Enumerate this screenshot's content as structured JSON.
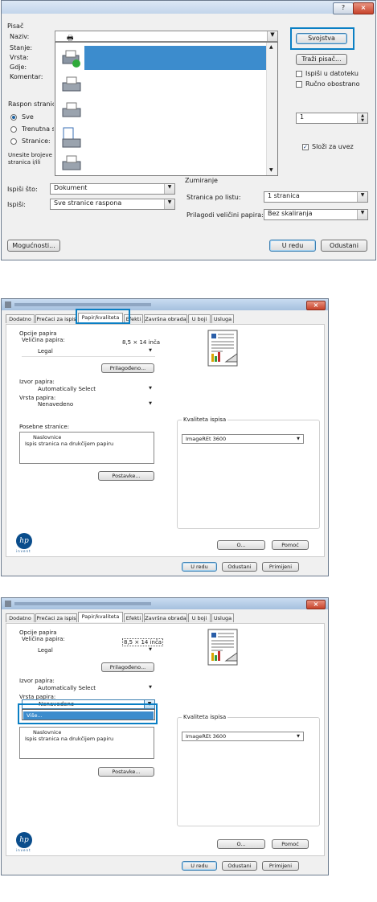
{
  "print_dialog": {
    "help_label": "?",
    "close_label": "×",
    "printer_section": "Pisač",
    "name_label": "Naziv:",
    "status_label": "Stanje:",
    "type_label": "Vrsta:",
    "where_label": "Gdje:",
    "comment_label": "Komentar:",
    "properties_button": "Svojstva",
    "find_printer_button": "Traži pisač...",
    "print_to_file_label": "Ispiši u datoteku",
    "manual_duplex_label": "Ručno obostrano",
    "page_range_label": "Raspon stranica",
    "all_label": "Sve",
    "current_label": "Trenutna s",
    "pages_label": "Stranice:",
    "range_hint": "Unesite brojeve stranica i/ili raspone stranica odvojene zarezima",
    "copies_value": "1",
    "collate_label": "Složi za uvez",
    "print_what_label": "Ispiši što:",
    "print_what_value": "Dokument",
    "print_label": "Ispiši:",
    "print_value": "Sve stranice raspona",
    "zoom_label": "Zumiranje",
    "pages_per_sheet_label": "Stranica po listu:",
    "pages_per_sheet_value": "1 stranica",
    "scale_label": "Prilagodi veličini papira:",
    "scale_value": "Bez skaliranja",
    "options_button": "Mogućnosti...",
    "ok_button": "U redu",
    "cancel_button": "Odustani"
  },
  "props_dialog": {
    "close_label": "×",
    "tabs": [
      "Dodatno",
      "Prečaci za ispis",
      "Papir/kvaliteta",
      "Efekti",
      "Završna obrada",
      "U boji",
      "Usluga"
    ],
    "paper_options_label": "Opcije papira",
    "paper_size_label": "Veličina papira:",
    "paper_size_dims": "8,5 × 14 inča",
    "paper_size_value": "Legal",
    "custom_button": "Prilagođeno...",
    "paper_source_label": "Izvor papira:",
    "paper_source_value": "Automatically Select",
    "paper_type_label": "Vrsta papira:",
    "paper_type_value": "Nenavedeno",
    "special_pages_label": "Posebne stranice:",
    "special_pages_items": [
      "Naslovnice",
      "Ispis stranica na drukčijem papiru"
    ],
    "settings_button": "Postavke...",
    "quality_label": "Kvaliteta ispisa",
    "quality_value": "ImageREt 3600",
    "about_button": "O...",
    "help_button": "Pomoć",
    "ok_button": "U redu",
    "cancel_button": "Odustani",
    "apply_button": "Primijeni",
    "logo_text": "hp",
    "logo_sub": "invent",
    "dropdown_more_item": "Više..."
  },
  "colors": {
    "highlight": "#0a7fc4",
    "selection": "#3c8ccd",
    "title_blue": "#a9c3e0"
  }
}
